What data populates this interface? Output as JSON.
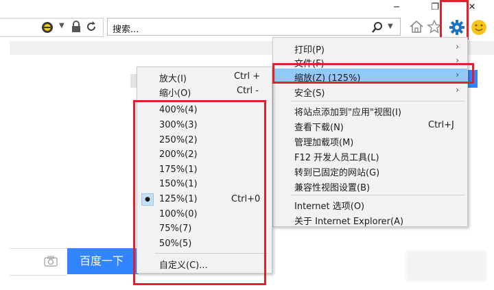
{
  "window": {
    "minimize": "−",
    "restore": "❐",
    "close": "✕"
  },
  "search": {
    "placeholder": "搜索..."
  },
  "baidu": {
    "button": "百度一下"
  },
  "tools_menu": {
    "items": [
      {
        "label": "打印(P)",
        "shortcut": "",
        "arrow": "›"
      },
      {
        "label": "文件(F)",
        "shortcut": "",
        "arrow": "›"
      },
      {
        "label": "缩放(Z) (125%)",
        "shortcut": "",
        "arrow": "›"
      },
      {
        "label": "安全(S)",
        "shortcut": "",
        "arrow": "›"
      },
      {
        "label": "将站点添加到\"应用\"视图(I)",
        "shortcut": "",
        "arrow": ""
      },
      {
        "label": "查看下载(N)",
        "shortcut": "Ctrl+J",
        "arrow": ""
      },
      {
        "label": "管理加载项(M)",
        "shortcut": "",
        "arrow": ""
      },
      {
        "label": "F12 开发人员工具(L)",
        "shortcut": "",
        "arrow": ""
      },
      {
        "label": "转到已固定的网站(G)",
        "shortcut": "",
        "arrow": ""
      },
      {
        "label": "兼容性视图设置(B)",
        "shortcut": "",
        "arrow": ""
      },
      {
        "label": "Internet 选项(O)",
        "shortcut": "",
        "arrow": ""
      },
      {
        "label": "关于 Internet Explorer(A)",
        "shortcut": "",
        "arrow": ""
      }
    ]
  },
  "zoom_menu": {
    "items": [
      {
        "label": "放大(I)",
        "shortcut": "Ctrl +"
      },
      {
        "label": "缩小(O)",
        "shortcut": "Ctrl -"
      },
      {
        "label": "400%(4)",
        "shortcut": ""
      },
      {
        "label": "300%(3)",
        "shortcut": ""
      },
      {
        "label": "250%(2)",
        "shortcut": ""
      },
      {
        "label": "200%(2)",
        "shortcut": ""
      },
      {
        "label": "175%(1)",
        "shortcut": ""
      },
      {
        "label": "150%(1)",
        "shortcut": ""
      },
      {
        "label": "125%(1)",
        "shortcut": "Ctrl+0"
      },
      {
        "label": "100%(0)",
        "shortcut": ""
      },
      {
        "label": "75%(7)",
        "shortcut": ""
      },
      {
        "label": "50%(5)",
        "shortcut": ""
      },
      {
        "label": "自定义(C)...",
        "shortcut": ""
      }
    ],
    "selected_bullet": "●"
  },
  "colors": {
    "highlight_red": "#e0202a",
    "hover_blue": "#91c9f7",
    "baidu_blue": "#3385ff",
    "gear_blue": "#1e73be"
  },
  "icons": [
    "compat-view-icon",
    "dropdown-arrow-icon",
    "lock-icon",
    "refresh-icon",
    "search-icon",
    "home-icon",
    "favorites-star-icon",
    "settings-gear-icon",
    "smiley-feedback-icon",
    "camera-icon"
  ]
}
